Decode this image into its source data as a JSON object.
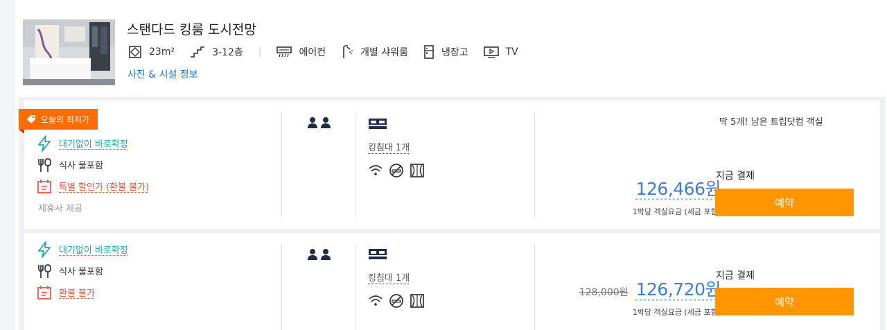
{
  "room": {
    "title": "스탠다드 킹룸 도시전망",
    "size": "23m²",
    "floors": "3-12층",
    "separator": "|",
    "aircon": "에어컨",
    "shower": "개별 샤워룸",
    "fridge": "냉장고",
    "tv": "TV",
    "photo_link": "사진 & 시설 정보"
  },
  "offers": [
    {
      "badge": "오늘의 최저가",
      "perks": [
        {
          "icon": "lightning-icon",
          "label": "대기없이 바로확정"
        },
        {
          "icon": "fork-knife-icon",
          "label": "식사 불포함"
        },
        {
          "icon": "calendar-icon",
          "label": "특별 할인가 (환불 불가)"
        }
      ],
      "provider": "제휴사 제공",
      "bed": "킹침대 1개",
      "availability": "딱 5개! 남은 트립닷컴 객실",
      "original_price": "",
      "price": "126,466원",
      "per_night": "1박당 객실요금 (세금 포함)",
      "pay_label": "지금 결제",
      "reserve": "예약"
    },
    {
      "perks": [
        {
          "icon": "lightning-icon",
          "label": "대기없이 바로확정"
        },
        {
          "icon": "fork-knife-icon",
          "label": "식사 불포함"
        },
        {
          "icon": "calendar-icon",
          "label": "환불 불가"
        }
      ],
      "bed": "킹침대 1개",
      "original_price": "128,000원",
      "price": "126,720원",
      "per_night": "1박당 객실요금 (세금 포함)",
      "pay_label": "지금 결제",
      "reserve": "예약"
    }
  ],
  "colors": {
    "accent_orange": "#ff9500",
    "badge_orange": "#ff6d00",
    "price_blue": "#3a7de0",
    "link_blue": "#1a73e8",
    "teal": "#1aa6b7",
    "red": "#e8503a"
  }
}
